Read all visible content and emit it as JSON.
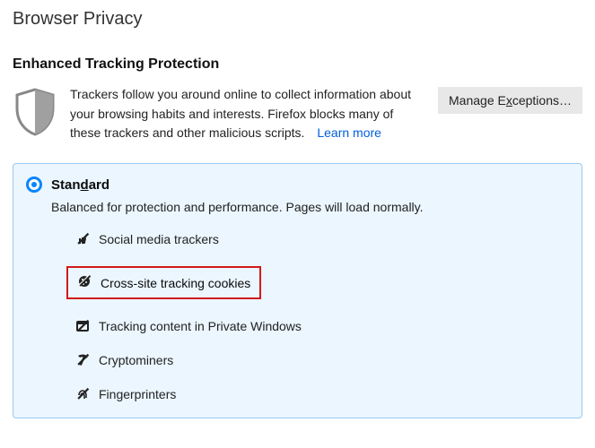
{
  "page": {
    "title": "Browser Privacy"
  },
  "etp": {
    "heading": "Enhanced Tracking Protection",
    "description": "Trackers follow you around online to collect information about your browsing habits and interests. Firefox blocks many of these trackers and other malicious scripts.",
    "learn_more": "Learn more",
    "manage_prefix": "Manage E",
    "manage_underline": "x",
    "manage_suffix": "ceptions…"
  },
  "standard": {
    "label_prefix": "Stan",
    "label_underline": "d",
    "label_suffix": "ard",
    "description": "Balanced for protection and performance. Pages will load normally.",
    "items": [
      {
        "label": "Social media trackers"
      },
      {
        "label": "Cross-site tracking cookies"
      },
      {
        "label": "Tracking content in Private Windows"
      },
      {
        "label": "Cryptominers"
      },
      {
        "label": "Fingerprinters"
      }
    ]
  }
}
